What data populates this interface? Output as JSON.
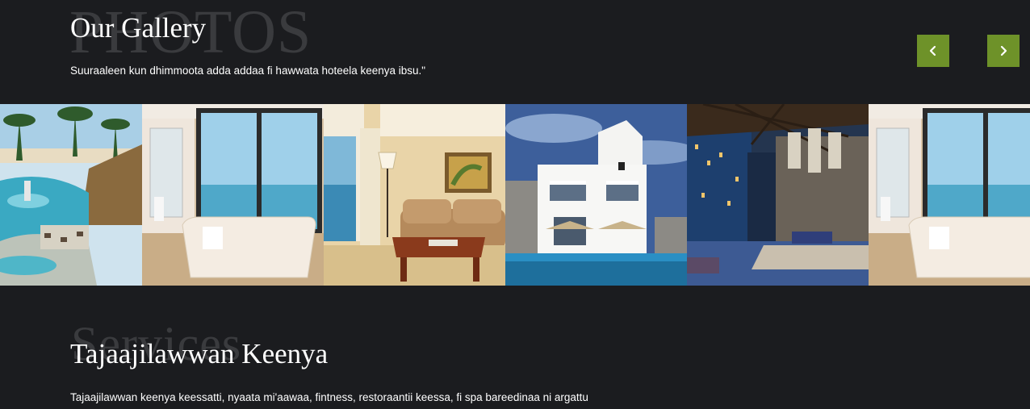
{
  "gallery": {
    "watermark": "PHOTOS",
    "title": "Our Gallery",
    "description": "Suuraaleen kun dhimmoota adda addaa fi hawwata hoteela keenya ibsu.\"",
    "prev_icon": "chevron-left-icon",
    "next_icon": "chevron-right-icon",
    "accent_color": "#6e9229",
    "photos": [
      {
        "subject": "resort-pool-photo"
      },
      {
        "subject": "bathroom-bathtub-photo"
      },
      {
        "subject": "hotel-room-sofa-photo"
      },
      {
        "subject": "white-villa-pool-photo"
      },
      {
        "subject": "hotel-lobby-photo"
      },
      {
        "subject": "bathroom-bathtub-photo"
      }
    ]
  },
  "services": {
    "watermark": "Services",
    "title": "Tajaajilawwan Keenya",
    "description": "Tajaajilawwan keenya keessatti, nyaata mi'aawaa, fintness, restoraantii keessa, fi spa bareedinaa ni argattu"
  },
  "theme": {
    "background": "#1b1c1f",
    "watermark_color": "#3a3b3e"
  }
}
